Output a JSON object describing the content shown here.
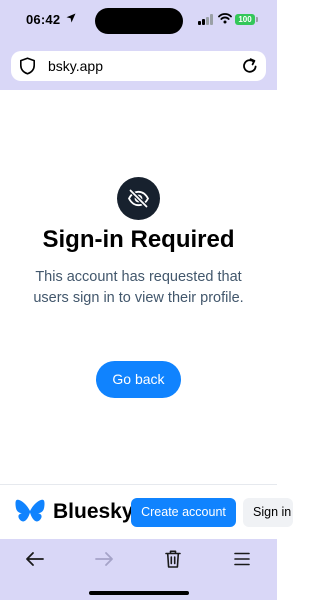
{
  "status_bar": {
    "time": "06:42",
    "battery": "100"
  },
  "browser": {
    "url": "bsky.app"
  },
  "content": {
    "title": "Sign-in Required",
    "description": "This account has requested that users sign in to view their profile.",
    "go_back_label": "Go back"
  },
  "bottom_bar": {
    "brand": "Bluesky",
    "create_account_label": "Create account",
    "sign_in_label": "Sign in"
  },
  "colors": {
    "accent": "#1083fe",
    "chrome": "#d9d7f7",
    "icon_circle": "#17212e",
    "description_text": "#42576c"
  },
  "icons": [
    "location-arrow-icon",
    "signal-icon",
    "wifi-icon",
    "battery-icon",
    "shield-icon",
    "reload-icon",
    "eye-slash-icon",
    "butterfly-icon",
    "back-arrow-icon",
    "forward-arrow-icon",
    "trash-icon",
    "menu-icon"
  ]
}
